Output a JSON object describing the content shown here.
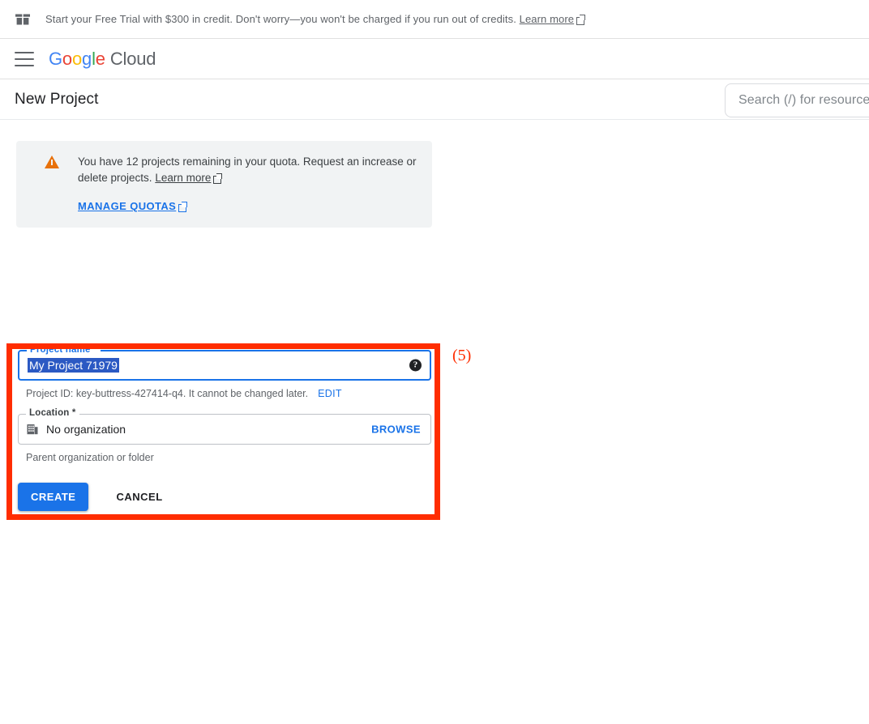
{
  "promo": {
    "icon": "gift-icon",
    "text_before": "Start your Free Trial with $300 in credit. Don't worry—you won't be charged if you run out of credits. ",
    "learn_more": "Learn more"
  },
  "appbar": {
    "menu_icon": "hamburger-menu-icon",
    "brand": {
      "g": "G",
      "o1": "o",
      "o2": "o",
      "g2": "g",
      "l": "l",
      "e": "e",
      "cloud": "Cloud"
    },
    "search": {
      "placeholder": "Search (/) for resources, docs, products, and more"
    }
  },
  "page": {
    "title": "New Project"
  },
  "quota": {
    "icon": "warning-triangle-icon",
    "message_before": "You have 12 projects remaining in your quota. Request an increase or delete projects. ",
    "learn_more": "Learn more",
    "manage_quotas": "MANAGE QUOTAS"
  },
  "annotation": {
    "marker": "(5)",
    "color": "#ff2d00"
  },
  "form": {
    "project_name": {
      "label": "Project name *",
      "value": "My Project 71979",
      "help_icon": "help-icon"
    },
    "project_id": {
      "text": "Project ID: key-buttress-427414-q4. It cannot be changed later.",
      "edit_label": "EDIT"
    },
    "location": {
      "label": "Location *",
      "icon": "organization-icon",
      "value": "No organization",
      "browse_label": "BROWSE",
      "helper": "Parent organization or folder"
    },
    "create_label": "CREATE",
    "cancel_label": "CANCEL"
  },
  "colors": {
    "accent_blue": "#1a73e8",
    "warning_orange": "#e8710a",
    "highlight_red": "#ff2d00",
    "selection_blue": "#2b59c3"
  }
}
